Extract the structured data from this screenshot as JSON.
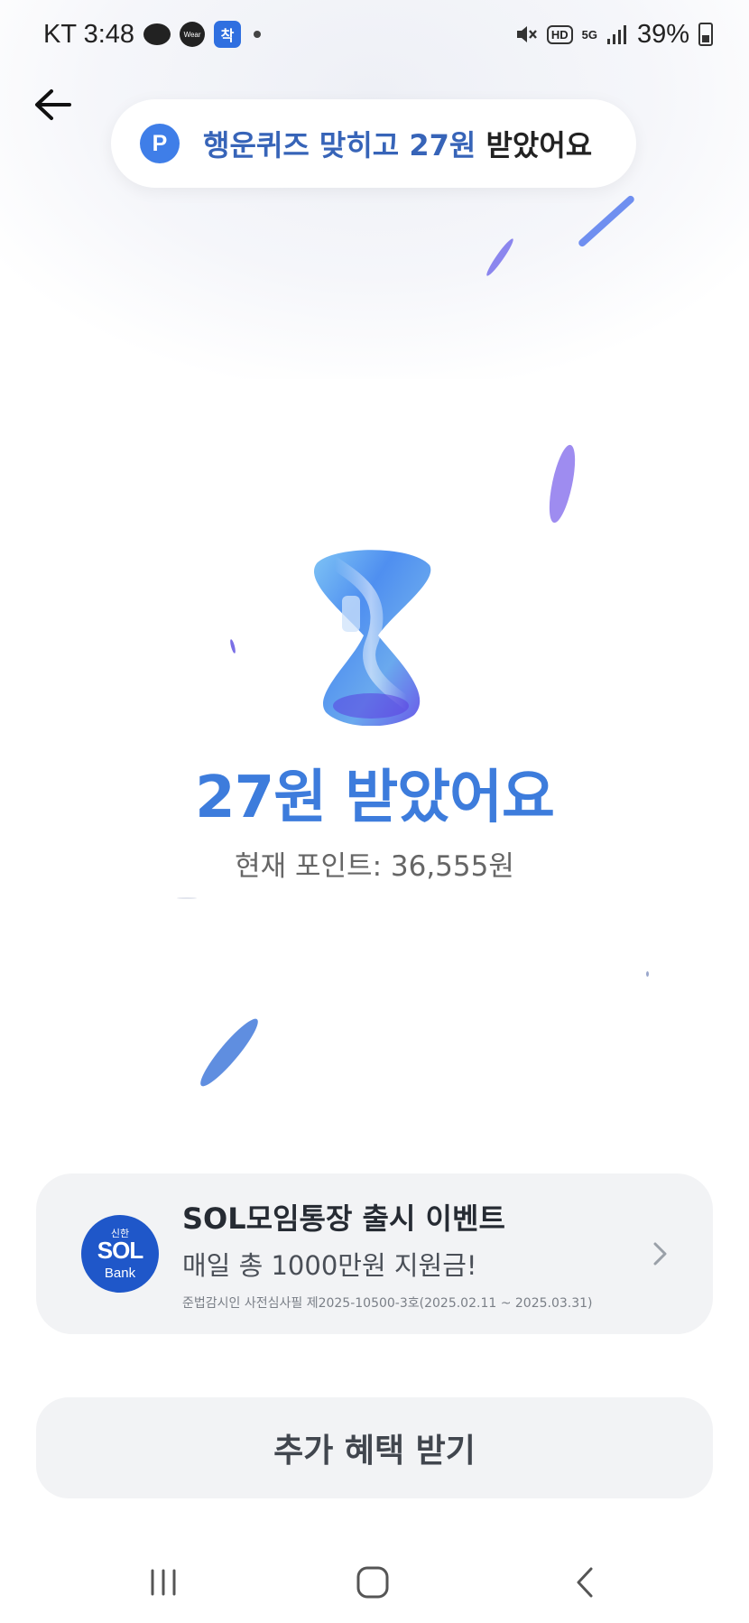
{
  "status_bar": {
    "carrier_time": "KT 3:48",
    "wear_label": "Wear",
    "chak_label": "착",
    "hd_label": "HD",
    "fiveg_label": "5G",
    "battery": "39%"
  },
  "toast": {
    "icon_label": "P",
    "text_highlight": "행운퀴즈 맞히고 27원 ",
    "text_rest": "받았어요"
  },
  "hero": {
    "title": "27원 받았어요",
    "current_points": "현재 포인트: 36,555원"
  },
  "event_card": {
    "logo_top": "신한",
    "logo_main": "SOL",
    "logo_bottom": "Bank",
    "title": "SOL모임통장 출시 이벤트",
    "description": "매일 총 1000만원 지원금!",
    "legal": "준법감시인 사전심사필 제2025-10500-3호(2025.02.11 ~ 2025.03.31)"
  },
  "extra_button": {
    "label": "추가 혜택 받기"
  },
  "colors": {
    "accent_blue": "#3d7cdc",
    "toast_text": "#3764b8",
    "card_bg": "#f2f3f5",
    "sol_blue": "#1f57c9"
  },
  "icons": {
    "back": "arrow-left-icon",
    "chevron": "chevron-right-icon",
    "nav_recent": "recent-apps-icon",
    "nav_home": "home-icon",
    "nav_back": "nav-back-icon"
  }
}
